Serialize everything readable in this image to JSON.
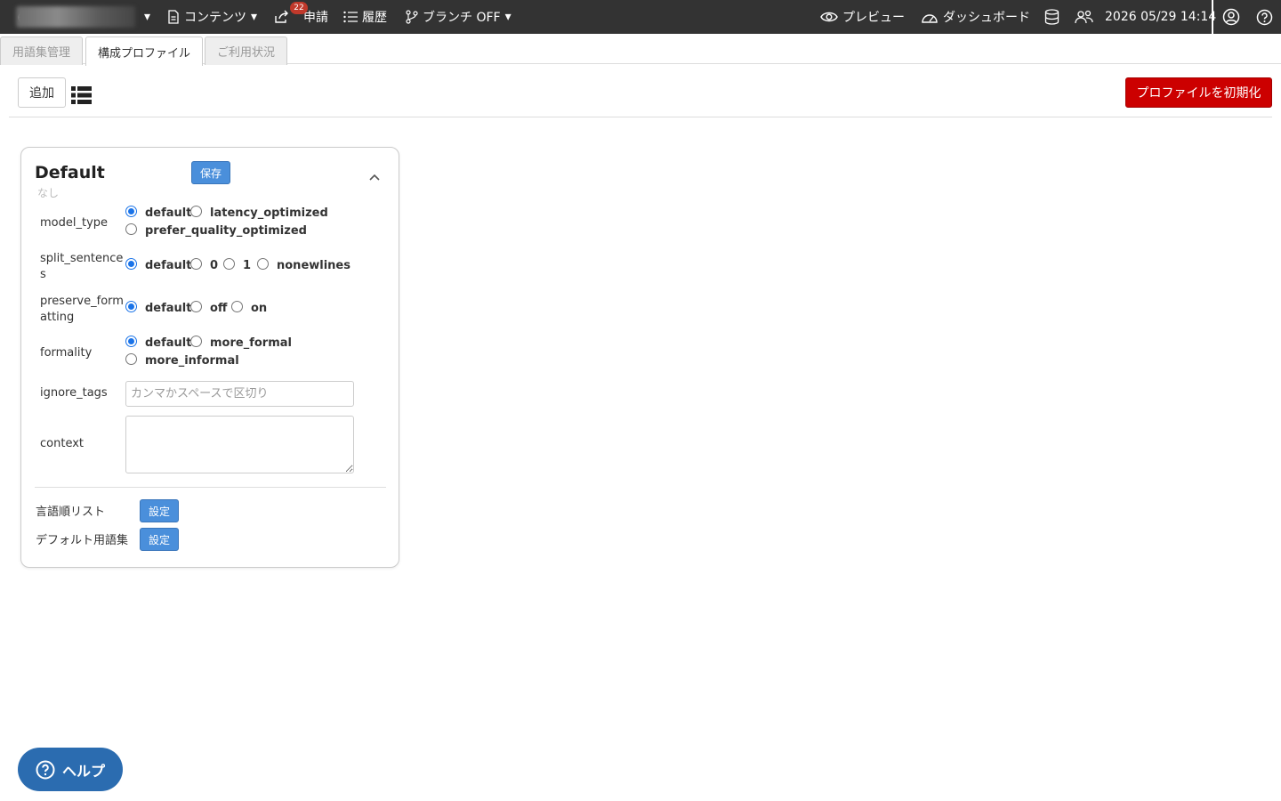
{
  "topbar": {
    "dropdown_caret": "▾",
    "content_label": "コンテンツ",
    "request_label": "申請",
    "request_badge": "22",
    "history_label": "履歴",
    "branch_label": "ブランチ OFF",
    "preview_label": "プレビュー",
    "dashboard_label": "ダッシュボード",
    "datetime": "2026 05/29 14:14"
  },
  "tabs": [
    {
      "label": "用語集管理"
    },
    {
      "label": "構成プロファイル"
    },
    {
      "label": "ご利用状況"
    }
  ],
  "toolbar": {
    "add_label": "追加",
    "reset_label": "プロファイルを初期化"
  },
  "profile": {
    "title": "Default",
    "subtitle": "なし",
    "save_label": "保存",
    "fields": {
      "model_type": {
        "label": "model_type",
        "options": [
          "default",
          "latency_optimized",
          "prefer_quality_optimized"
        ],
        "selected": "default"
      },
      "split_sentences": {
        "label_line1": "split_sentence",
        "label_line2": "s",
        "options": [
          "default",
          "0",
          "1",
          "nonewlines"
        ],
        "selected": "default"
      },
      "preserve_formatting": {
        "label_line1": "preserve_form",
        "label_line2": "atting",
        "options": [
          "default",
          "off",
          "on"
        ],
        "selected": "default"
      },
      "formality": {
        "label": "formality",
        "options": [
          "default",
          "more_formal",
          "more_informal"
        ],
        "selected": "default"
      },
      "ignore_tags": {
        "label": "ignore_tags",
        "placeholder": "カンマかスペースで区切り",
        "value": ""
      },
      "context": {
        "label": "context",
        "value": ""
      }
    },
    "language_order": {
      "label": "言語順リスト",
      "button": "設定"
    },
    "default_glossary": {
      "label": "デフォルト用語集",
      "button": "設定"
    }
  },
  "help": {
    "label": "ヘルプ"
  },
  "colors": {
    "topbar_bg": "#333333",
    "primary_blue": "#4a8fdb",
    "danger_red": "#cc0000",
    "help_blue": "#2b6cb0",
    "badge_red": "#c0392b"
  }
}
